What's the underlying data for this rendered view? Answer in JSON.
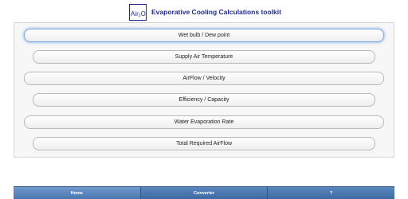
{
  "header": {
    "logo": {
      "main": "Air",
      "sub": "2",
      "suffix": "O"
    },
    "title": "Evaporative Cooling Calculations toolkit"
  },
  "menu": {
    "items": [
      {
        "label": "Wet bulb / Dew point"
      },
      {
        "label": "Supply Air Temperature"
      },
      {
        "label": "AirFlow / Velocity"
      },
      {
        "label": "Efficiency / Capacity"
      },
      {
        "label": "Water Evaporation Rate"
      },
      {
        "label": "Total Required AirFlow"
      }
    ]
  },
  "navbar": {
    "items": [
      {
        "label": "Home"
      },
      {
        "label": "Converter"
      },
      {
        "label": "?"
      }
    ]
  },
  "colors": {
    "brand": "#1f2a8c",
    "nav_bar": "#4a77b0",
    "focus_ring": "#a8c6ef"
  }
}
